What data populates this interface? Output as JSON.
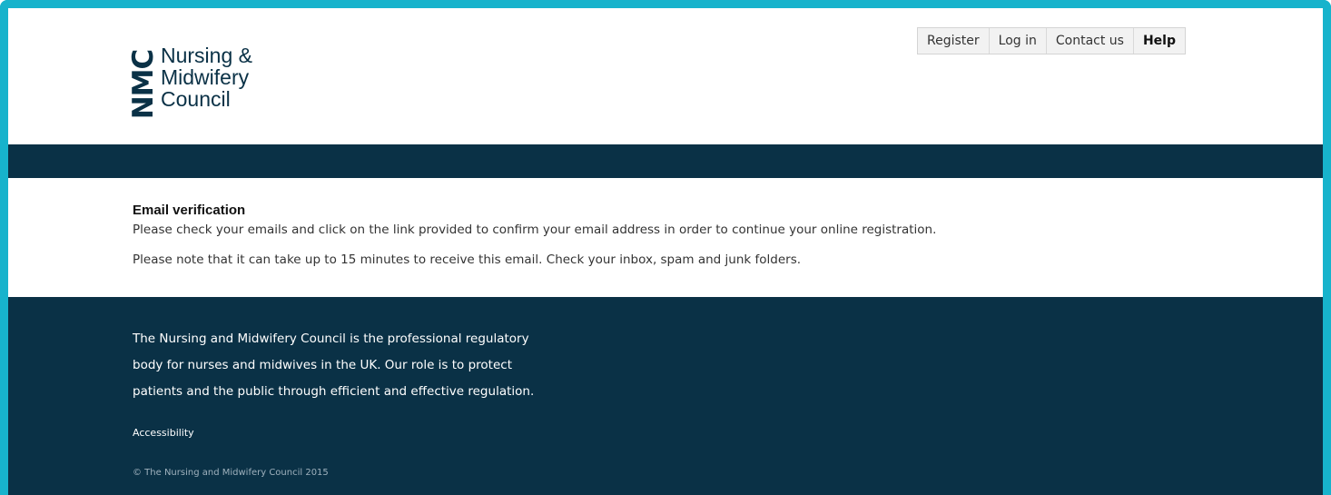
{
  "header": {
    "logo": {
      "mark": "NMC",
      "lines": [
        "Nursing &",
        "Midwifery",
        "Council"
      ]
    },
    "nav": [
      {
        "label": "Register"
      },
      {
        "label": "Log in"
      },
      {
        "label": "Contact us"
      },
      {
        "label": "Help"
      }
    ]
  },
  "main": {
    "heading": "Email verification",
    "paragraph1": "Please check your emails and click on the link provided to confirm your email address in order to continue your online registration.",
    "paragraph2": "Please note that it can take up to 15 minutes to receive this email. Check your inbox, spam and junk folders."
  },
  "footer": {
    "about_lines": [
      "The Nursing and Midwifery Council is the professional regulatory",
      "body for nurses and midwives in the UK. Our role is to protect",
      "patients and the public through efficient and effective regulation."
    ],
    "accessibility_link": "Accessibility",
    "copyright": "© The Nursing and Midwifery Council 2015"
  },
  "colors": {
    "frame": "#17b3cc",
    "brand_navy": "#0a3146"
  }
}
